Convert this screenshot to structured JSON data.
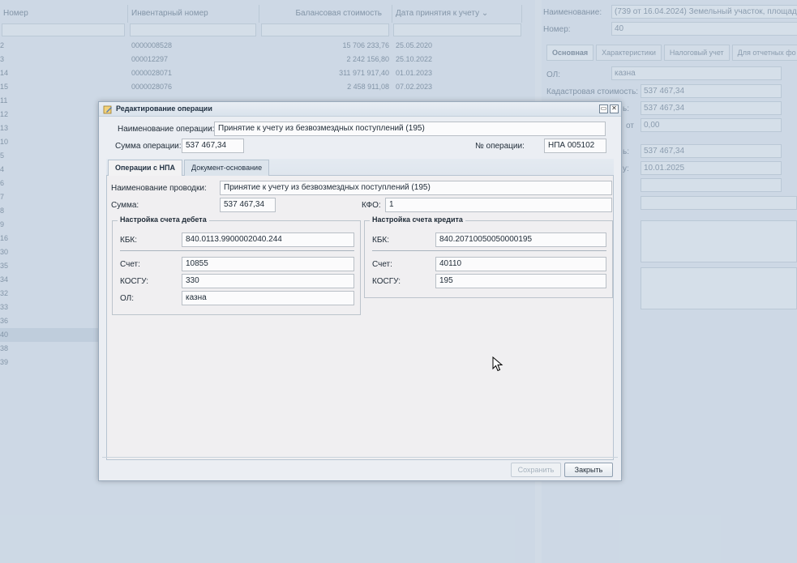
{
  "background": {
    "grid": {
      "columns": [
        "Номер",
        "Инвентарный номер",
        "Балансовая стоимость",
        "Дата принятия к учету"
      ],
      "rows": [
        {
          "num": "2",
          "inv": "0000008528",
          "cost": "15 706 233,76",
          "date": "25.05.2020"
        },
        {
          "num": "3",
          "inv": "000012297",
          "cost": "2 242 156,80",
          "date": "25.10.2022"
        },
        {
          "num": "14",
          "inv": "0000028071",
          "cost": "311 971 917,40",
          "date": "01.01.2023"
        },
        {
          "num": "15",
          "inv": "0000028076",
          "cost": "2 458 911,08",
          "date": "07.02.2023"
        },
        {
          "num": "11",
          "inv": "",
          "cost": "",
          "date": ""
        },
        {
          "num": "12",
          "inv": "",
          "cost": "",
          "date": ""
        },
        {
          "num": "13",
          "inv": "",
          "cost": "",
          "date": ""
        },
        {
          "num": "10",
          "inv": "",
          "cost": "",
          "date": ""
        },
        {
          "num": "5",
          "inv": "",
          "cost": "",
          "date": ""
        },
        {
          "num": "4",
          "inv": "",
          "cost": "",
          "date": ""
        },
        {
          "num": "6",
          "inv": "",
          "cost": "",
          "date": ""
        },
        {
          "num": "7",
          "inv": "",
          "cost": "",
          "date": ""
        },
        {
          "num": "8",
          "inv": "",
          "cost": "",
          "date": ""
        },
        {
          "num": "9",
          "inv": "",
          "cost": "",
          "date": ""
        },
        {
          "num": "16",
          "inv": "",
          "cost": "",
          "date": ""
        },
        {
          "num": "30",
          "inv": "",
          "cost": "",
          "date": ""
        },
        {
          "num": "35",
          "inv": "",
          "cost": "",
          "date": ""
        },
        {
          "num": "34",
          "inv": "",
          "cost": "",
          "date": ""
        },
        {
          "num": "32",
          "inv": "",
          "cost": "",
          "date": ""
        },
        {
          "num": "33",
          "inv": "",
          "cost": "",
          "date": ""
        },
        {
          "num": "36",
          "inv": "",
          "cost": "",
          "date": ""
        },
        {
          "num": "40",
          "inv": "",
          "cost": "",
          "date": ""
        },
        {
          "num": "38",
          "inv": "",
          "cost": "",
          "date": ""
        },
        {
          "num": "39",
          "inv": "",
          "cost": "",
          "date": ""
        }
      ]
    },
    "details": {
      "name_label": "Наименование:",
      "name_value": "(739 от 16.04.2024) Земельный участок, площадь",
      "number_label": "Номер:",
      "number_value": "40",
      "tabs": [
        "Основная",
        "Характеристики",
        "Налоговый учет",
        "Для отчетных фо"
      ],
      "ol_label": "ОЛ:",
      "ol_value": "казна",
      "cadastral_label": "Кадастровая стоимость:",
      "cadastral_value": "537 467,34",
      "f2_label": "ь:",
      "f2_value": "537 467,34",
      "f3_label": "от",
      "f3_value": "0,00",
      "f4_label": "ь:",
      "f4_value": "537 467,34",
      "f5_label": "у:",
      "f5_value": "10.01.2025"
    }
  },
  "dialog": {
    "title": "Редактирование операции",
    "operation_name_label": "Наименование операции:",
    "operation_name_value": "Принятие к учету из безвозмездных поступлений (195)",
    "operation_sum_label": "Сумма операции:",
    "operation_sum_value": "537 467,34",
    "operation_no_label": "№ операции:",
    "operation_no_value": "НПА 005102",
    "tabs": {
      "tab1": "Операции с НПА",
      "tab2": "Документ-основание"
    },
    "posting_name_label": "Наименование проводки:",
    "posting_name_value": "Принятие к учету из безвозмездных поступлений (195)",
    "sum_label": "Сумма:",
    "sum_value": "537 467,34",
    "kfo_label": "КФО:",
    "kfo_value": "1",
    "debit": {
      "legend": "Настройка счета дебета",
      "kbk_label": "КБК:",
      "kbk_value": "840.0113.9900002040.244",
      "account_label": "Счет:",
      "account_value": "10855",
      "kosgu_label": "КОСГУ:",
      "kosgu_value": "330",
      "ol_label": "ОЛ:",
      "ol_value": "казна"
    },
    "credit": {
      "legend": "Настройка счета кредита",
      "kbk_label": "КБК:",
      "kbk_value": "840.20710050050000195",
      "account_label": "Счет:",
      "account_value": "40110",
      "kosgu_label": "КОСГУ:",
      "kosgu_value": "195"
    },
    "save_button": "Сохранить",
    "close_button": "Закрыть"
  }
}
